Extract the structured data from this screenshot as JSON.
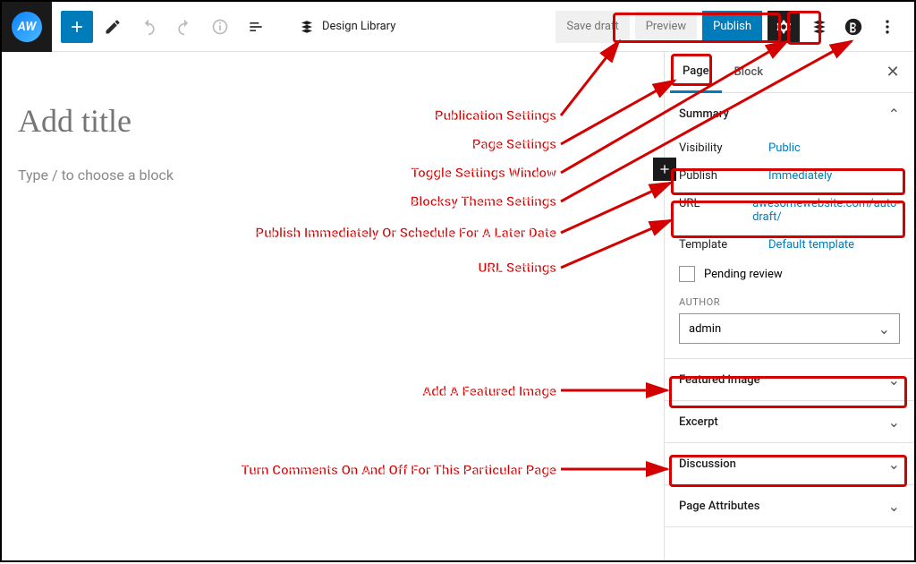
{
  "logo": {
    "text": "AW"
  },
  "toolbar": {
    "design_library": "Design Library",
    "save_draft": "Save draft",
    "preview": "Preview",
    "publish": "Publish"
  },
  "editor": {
    "title_placeholder": "Add title",
    "block_hint": "Type / to choose a block"
  },
  "sidebar": {
    "tabs": {
      "page": "Page",
      "block": "Block"
    },
    "summary": {
      "heading": "Summary",
      "visibility": {
        "label": "Visibility",
        "value": "Public"
      },
      "publish": {
        "label": "Publish",
        "value": "Immediately"
      },
      "url": {
        "label": "URL",
        "value": "awesomewebsite.com/auto-draft/"
      },
      "template": {
        "label": "Template",
        "value": "Default template"
      },
      "pending_review": "Pending review",
      "author_label": "AUTHOR",
      "author_value": "admin"
    },
    "panels": {
      "featured_image": "Featured image",
      "excerpt": "Excerpt",
      "discussion": "Discussion",
      "page_attributes": "Page Attributes"
    }
  },
  "annotations": {
    "publication_settings": "Publication Settings",
    "page_settings": "Page Settings",
    "toggle_settings": "Toggle Settings Window",
    "blocksy_theme": "Blocksy Theme Settings",
    "publish_schedule": "Publish Immediately Or Schedule For A Later Date",
    "url_settings": "URL Settings",
    "featured_image": "Add A Featured Image",
    "discussion": "Turn Comments On And Off For This Particular Page"
  }
}
